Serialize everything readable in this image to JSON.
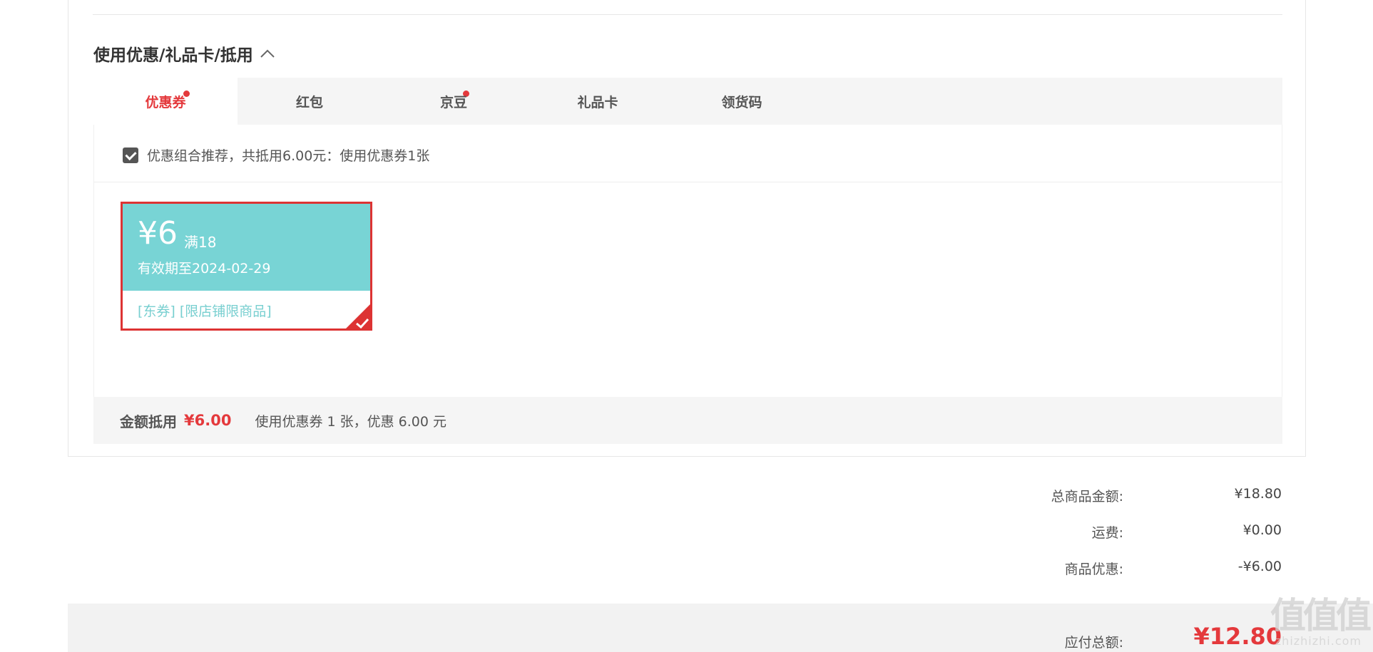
{
  "section": {
    "title": "使用优惠/礼品卡/抵用"
  },
  "tabs": [
    {
      "label": "优惠券",
      "active": true,
      "dot": true
    },
    {
      "label": "红包",
      "active": false,
      "dot": true
    },
    {
      "label": "京豆",
      "active": false,
      "dot": false
    },
    {
      "label": "礼品卡",
      "active": false,
      "dot": false
    },
    {
      "label": "领货码",
      "active": false,
      "dot": false
    }
  ],
  "recommend": {
    "checked": true,
    "text": "优惠组合推荐，共抵用6.00元：使用优惠券1张"
  },
  "coupon": {
    "amount": "¥6",
    "condition": "满18",
    "validity": "有效期至2024-02-29",
    "tags": "[东券] [限店铺限商品]",
    "selected": true,
    "colors": {
      "face": "#78d4d5",
      "border": "#dd3333"
    }
  },
  "summary": {
    "label": "金额抵用",
    "value": "¥6.00",
    "desc": "使用优惠券 1 张，优惠 6.00 元"
  },
  "totals": [
    {
      "label": "总商品金额:",
      "value": "¥18.80"
    },
    {
      "label": "运费:",
      "value": "¥0.00"
    },
    {
      "label": "商品优惠:",
      "value": "-¥6.00"
    }
  ],
  "pay": {
    "label": "应付总额:",
    "value": "¥12.80"
  },
  "watermark": {
    "logo": "值值值",
    "url": "zhizhizhi.com"
  },
  "colors": {
    "accent": "#e4393c",
    "tabbar": "#f5f5f5",
    "text": "#555555"
  }
}
